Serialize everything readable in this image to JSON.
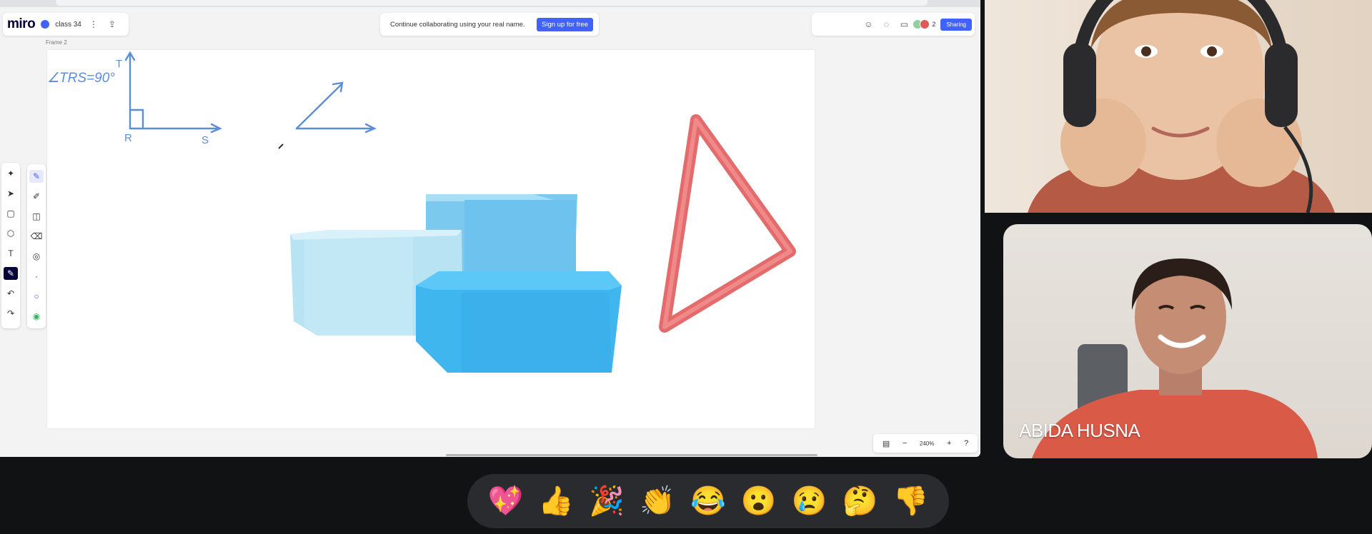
{
  "miro": {
    "logo": "miro",
    "board_name": "class 34",
    "collab_message": "Continue collaborating using your real name.",
    "signup_label": "Sign up for free",
    "user_count": "2",
    "share_label": "Sharing",
    "frame_label": "Frame 2",
    "zoom": "240%",
    "accent": "#4262ff"
  },
  "canvas": {
    "angle_text": "∠TRS=90°",
    "point_t": "T",
    "point_r": "R",
    "point_s": "S"
  },
  "toolbar": {
    "main_tools": [
      "select-icon",
      "sticky-note-icon",
      "shapes-icon",
      "text-icon",
      "pen-icon",
      "undo-icon",
      "redo-icon"
    ],
    "pen_tools": [
      "pen-icon",
      "highlighter-icon",
      "shapes-pen-icon",
      "eraser-icon",
      "lasso-icon"
    ]
  },
  "participants": [
    {
      "name": "ABIDA HUSNA"
    }
  ],
  "reactions": [
    "💖",
    "👍",
    "🎉",
    "👏",
    "😂",
    "😮",
    "😢",
    "🤔",
    "👎"
  ]
}
